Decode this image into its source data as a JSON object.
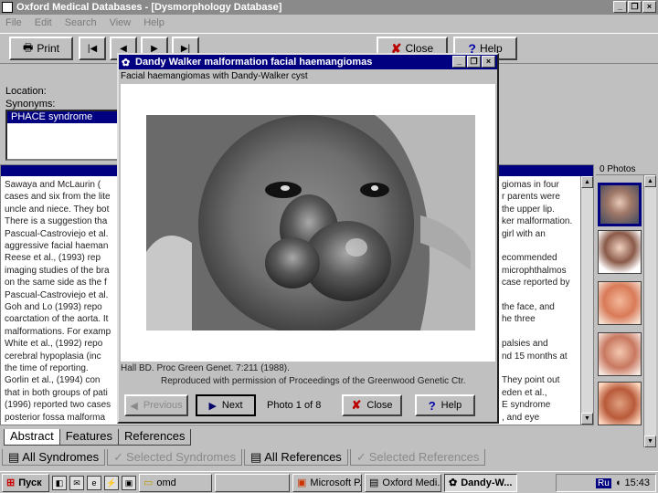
{
  "window": {
    "title": "Oxford Medical Databases - [Dysmorphology Database]",
    "min_glyph": "_",
    "max_glyph": "❐",
    "close_glyph": "×"
  },
  "menu": [
    "File",
    "Edit",
    "Search",
    "View",
    "Help"
  ],
  "toolbar": {
    "print_label": "Print",
    "close_label": "Close",
    "help_label": "Help",
    "nav_first": "|◀",
    "nav_prev": "◀",
    "nav_next": "▶",
    "nav_last": "▶|"
  },
  "location_label": "Location:",
  "synonyms_label": "Synonyms:",
  "synonyms": [
    "PHACE syndrome"
  ],
  "text_panel": {
    "lines": [
      "Sawaya and McLaurin (",
      "cases and six from the lite",
      "uncle and niece. They bot",
      "There is a suggestion tha",
      "Pascual-Castroviejo et al.",
      "aggressive facial haeman",
      "Reese et al., (1993) rep",
      "imaging studies of the bra",
      "on the same side as the f",
      "Pascual-Castroviejo et al.",
      "Goh and Lo (1993) repo",
      "coarctation of the aorta. It",
      "malformations. For examp",
      "White et al., (1992) repo",
      "cerebral hypoplasia (inc",
      "the time of reporting.",
      "Gorlin et al., (1994) con",
      "that in both groups of pati",
      "(1996) reported two cases",
      "posterior fossa malforma"
    ],
    "right_lines": [
      "giomas in four",
      "r parents were",
      "the upper lip.",
      "ker malformation.",
      "girl with an",
      "",
      "ecommended",
      "microphthalmos",
      "case reported by",
      "",
      "the face, and",
      "he three",
      "",
      "palsies and",
      "nd 15 months at",
      "",
      "They point out",
      "eden et al.,",
      "E syndrome",
      ", and eye"
    ]
  },
  "photos_panel": {
    "header": "0 Photos"
  },
  "tabs": [
    "Abstract",
    "Features",
    "References"
  ],
  "lower_tabs": [
    {
      "label": "All Syndromes",
      "dim": false
    },
    {
      "label": "Selected Syndromes",
      "dim": true
    },
    {
      "label": "All References",
      "dim": false
    },
    {
      "label": "Selected References",
      "dim": true
    }
  ],
  "dialog": {
    "title": "Dandy Walker malformation facial haemangiomas",
    "caption": "Facial haemangiomas with Dandy-Walker cyst",
    "credit_ref": "Hall BD. Proc Green Genet. 7:211 (1988).",
    "credit_permission": "Reproduced with permission of Proceedings of the Greenwood Genetic Ctr.",
    "previous_label": "Previous",
    "next_label": "Next",
    "counter": "Photo 1 of 8",
    "close_label": "Close",
    "help_label": "Help"
  },
  "taskbar": {
    "start_label": "Пуск",
    "quick": [
      "◧",
      "✉",
      "e",
      "⚡",
      "▣"
    ],
    "tasks": [
      {
        "label": "omd",
        "pressed": false
      },
      {
        "label": "",
        "pressed": false
      },
      {
        "label": "Microsoft P...",
        "pressed": false
      },
      {
        "label": "Oxford Medi...",
        "pressed": false
      },
      {
        "label": "Dandy-W...",
        "pressed": true
      }
    ],
    "lang": "Ru",
    "time": "15:43"
  },
  "colors": {
    "titlebar_inactive": "#8a8a8a",
    "titlebar_active": "#000080",
    "selection": "#000080"
  }
}
